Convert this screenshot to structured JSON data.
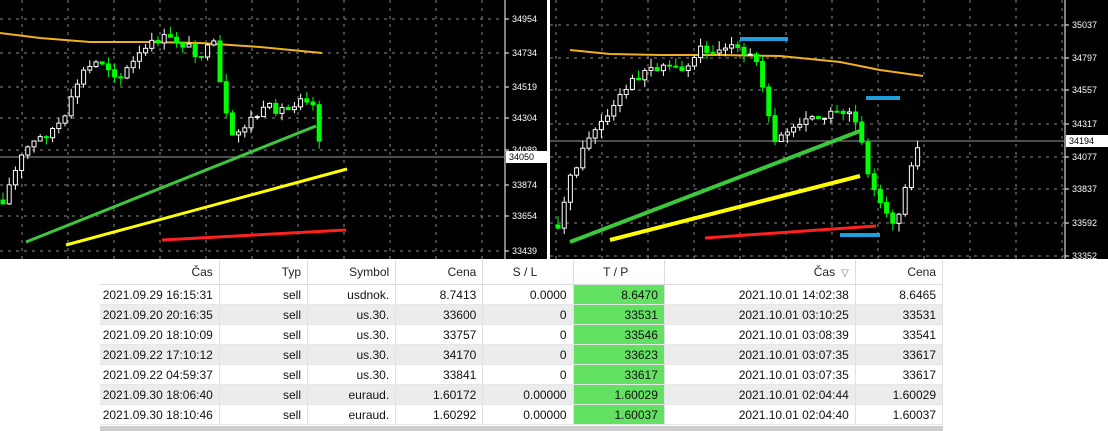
{
  "charts": {
    "left": {
      "price_levels": [
        "34954",
        "34734",
        "34519",
        "34304",
        "34089",
        "33874",
        "33654",
        "33439"
      ],
      "current_price": "34050",
      "colors": {
        "bull": "#ffffff",
        "bear": "#00ff00",
        "ma": "#f0b020"
      }
    },
    "right": {
      "price_levels": [
        "35037",
        "34797",
        "34557",
        "34317",
        "34077",
        "33837",
        "33592",
        "33352"
      ],
      "current_price": "34194",
      "colors": {
        "bull": "#ffffff",
        "bear": "#00ff00",
        "ma": "#f0b020"
      }
    },
    "annotation_colors": {
      "green": "#3cc83c",
      "yellow": "#ffff00",
      "red": "#ff2020",
      "blue": "#1e9fdc"
    }
  },
  "table": {
    "headers": {
      "time": "Čas",
      "type": "Typ",
      "symbol": "Symbol",
      "price": "Cena",
      "sl": "S / L",
      "tp": "T / P",
      "close_time": "Čas",
      "close_price": "Cena"
    },
    "rows": [
      {
        "time": "2021.09.29 16:15:31",
        "type": "sell",
        "symbol": "usdnok.",
        "price": "8.7413",
        "sl": "0.0000",
        "tp": "8.6470",
        "close_time": "2021.10.01 14:02:38",
        "close_price": "8.6465"
      },
      {
        "time": "2021.09.20 20:16:35",
        "type": "sell",
        "symbol": "us.30.",
        "price": "33600",
        "sl": "0",
        "tp": "33531",
        "close_time": "2021.10.01 03:10:25",
        "close_price": "33531"
      },
      {
        "time": "2021.09.20 18:10:09",
        "type": "sell",
        "symbol": "us.30.",
        "price": "33757",
        "sl": "0",
        "tp": "33546",
        "close_time": "2021.10.01 03:08:39",
        "close_price": "33541"
      },
      {
        "time": "2021.09.22 17:10:12",
        "type": "sell",
        "symbol": "us.30.",
        "price": "34170",
        "sl": "0",
        "tp": "33623",
        "close_time": "2021.10.01 03:07:35",
        "close_price": "33617"
      },
      {
        "time": "2021.09.22 04:59:37",
        "type": "sell",
        "symbol": "us.30.",
        "price": "33841",
        "sl": "0",
        "tp": "33617",
        "close_time": "2021.10.01 03:07:35",
        "close_price": "33617"
      },
      {
        "time": "2021.09.30 18:06:40",
        "type": "sell",
        "symbol": "euraud.",
        "price": "1.60172",
        "sl": "0.00000",
        "tp": "1.60029",
        "close_time": "2021.10.01 02:04:44",
        "close_price": "1.60029"
      },
      {
        "time": "2021.09.30 18:10:46",
        "type": "sell",
        "symbol": "euraud.",
        "price": "1.60292",
        "sl": "0.00000",
        "tp": "1.60037",
        "close_time": "2021.10.01 02:04:40",
        "close_price": "1.60037"
      }
    ],
    "tp_highlight_color": "#63e163"
  }
}
